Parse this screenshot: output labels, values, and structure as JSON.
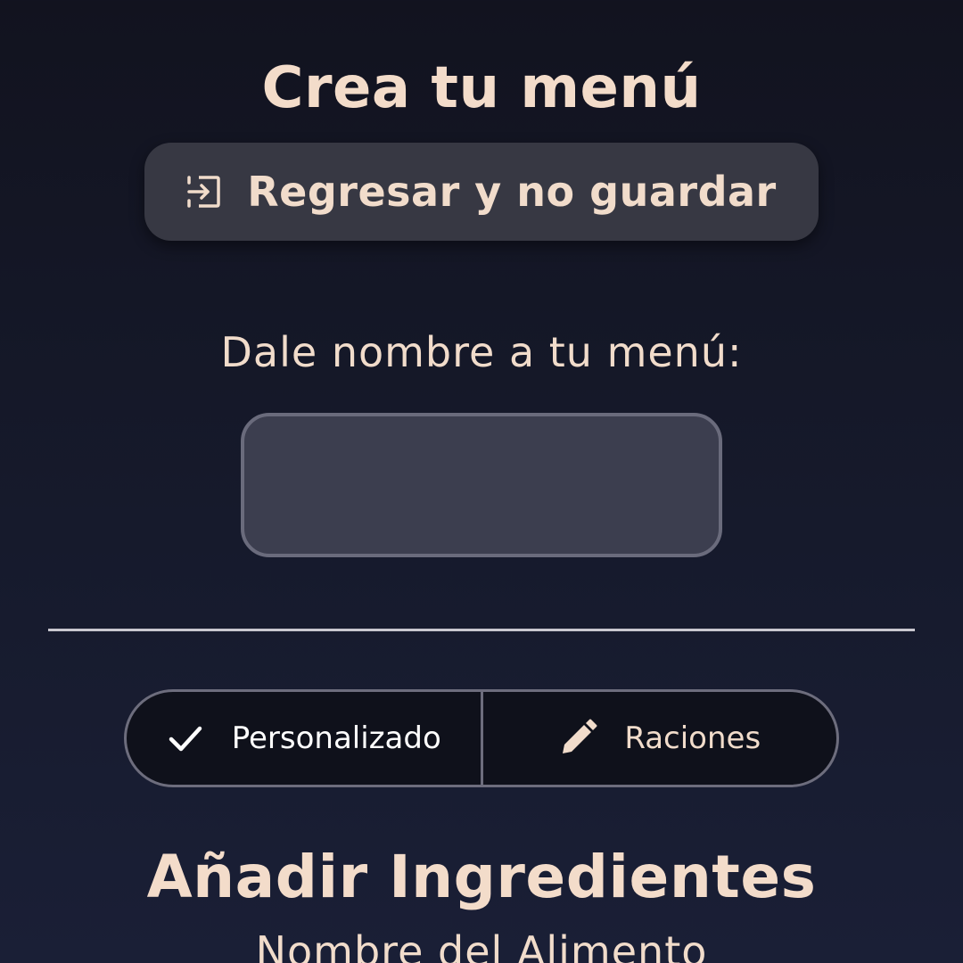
{
  "header": {
    "title": "Crea tu menú"
  },
  "back_button": {
    "label": "Regresar y no guardar",
    "icon": "exit-arrow-icon"
  },
  "menu_name": {
    "label": "Dale nombre a tu menú:",
    "value": "",
    "placeholder": ""
  },
  "mode_toggle": {
    "options": [
      {
        "label": "Personalizado",
        "icon": "check-icon",
        "selected": true
      },
      {
        "label": "Raciones",
        "icon": "pencil-icon",
        "selected": false
      }
    ]
  },
  "ingredients": {
    "title": "Añadir Ingredientes",
    "food_name_label": "Nombre del Alimento"
  },
  "colors": {
    "accent_text": "#f3dcca",
    "button_bg": "#373843",
    "input_bg": "#3c3e4f",
    "background": "#12131f"
  }
}
